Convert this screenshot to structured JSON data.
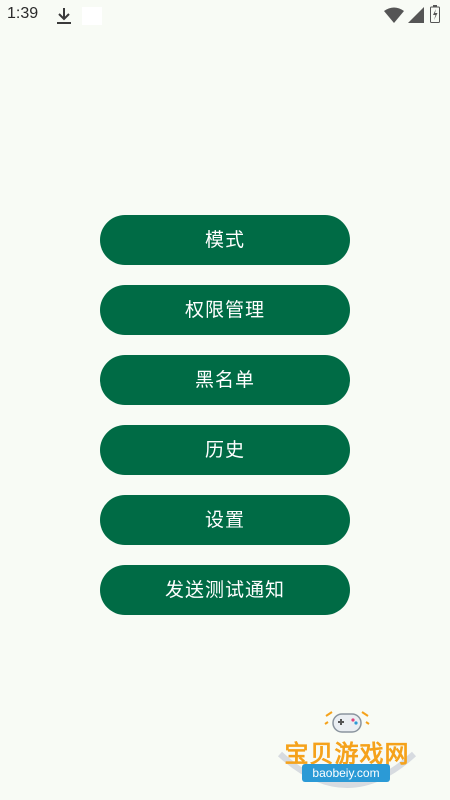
{
  "status_bar": {
    "time": "1:39"
  },
  "menu": {
    "items": [
      {
        "label": "模式"
      },
      {
        "label": "权限管理"
      },
      {
        "label": "黑名单"
      },
      {
        "label": "历史"
      },
      {
        "label": "设置"
      },
      {
        "label": "发送测试通知"
      }
    ]
  },
  "watermark": {
    "title": "宝贝游戏网",
    "domain": "baobeiy.com"
  },
  "colors": {
    "background": "#f8fbf5",
    "button": "#006b45",
    "button_text": "#ffffff"
  }
}
